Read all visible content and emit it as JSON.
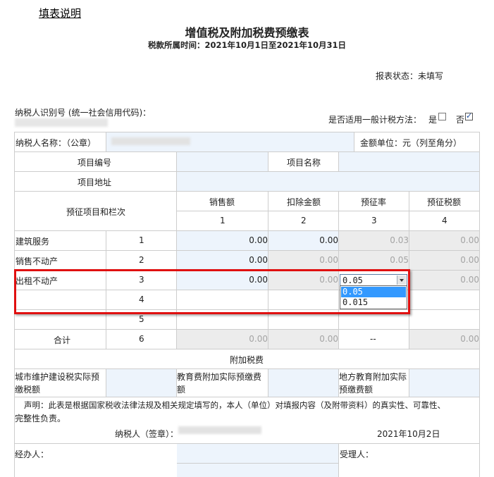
{
  "header": {
    "help_link": "填表说明",
    "title": "增值税及附加税费预缴表",
    "period": "税款所属时间：2021年10月1日至2021年10月31日",
    "status": "报表状态：未填写"
  },
  "taxpayer": {
    "id_label": "纳税人识别号 (统一社会信用代码)：",
    "general_method_label": "是否适用一般计税方法：",
    "yes_label": "是",
    "no_label": "否",
    "yes_checked": false,
    "no_checked": true,
    "name_label": "纳税人名称：（公章）",
    "amount_unit": "金额单位：元（列至角分）"
  },
  "project": {
    "number_label": "项目编号",
    "name_label": "项目名称",
    "address_label": "项目地址"
  },
  "table": {
    "item_header": "预征项目和栏次",
    "columns": [
      "销售额",
      "扣除金额",
      "预征率",
      "预征税额"
    ],
    "column_numbers": [
      "1",
      "2",
      "3",
      "4"
    ],
    "rows": [
      {
        "label": "建筑服务",
        "no": "1",
        "sales": "0.00",
        "deduct": "0.00",
        "rate": "0.03",
        "tax": "0.00"
      },
      {
        "label": "销售不动产",
        "no": "2",
        "sales": "0.00",
        "deduct": "0.00",
        "rate": "0.05",
        "tax": "0.00"
      },
      {
        "label": "出租不动产",
        "no": "3",
        "sales": "0.00",
        "deduct": "0.00",
        "rate": "0.05",
        "tax": "0.00"
      },
      {
        "label": "",
        "no": "4",
        "sales": "",
        "deduct": "",
        "rate": "",
        "tax": ""
      },
      {
        "label": "",
        "no": "5",
        "sales": "",
        "deduct": "",
        "rate": "",
        "tax": ""
      }
    ],
    "total": {
      "label": "合计",
      "no": "6",
      "sales": "0.00",
      "deduct": "0.00",
      "rate": "--",
      "tax": "0.00"
    }
  },
  "rate_dropdown": {
    "selected": "0.05",
    "options": [
      "0.05",
      "0.015"
    ]
  },
  "surcharge": {
    "title": "附加税费",
    "urban_label_1": "城市维护建设税实际预",
    "urban_label_2": "缴税额",
    "edu_label_1": "教育费附加实际预缴费",
    "edu_label_2": "额",
    "local_edu_label_1": "地方教育附加实际",
    "local_edu_label_2": "预缴费额"
  },
  "declaration": {
    "line1": "声明：此表是根据国家税收法律法规及相关规定填写的，本人（单位）对填报内容（及附带资料）的真实性、可靠性、",
    "line2": "完整性负责。",
    "signature_label": "纳税人（签章）：",
    "date": "2021年10月2日"
  },
  "footer": {
    "handler_label": "经办人：",
    "receiver_label": "受理人："
  },
  "colors": {
    "input_blue": "#edf4fc",
    "readonly_gray": "#ececec",
    "grid": "#cdcdcd",
    "highlight_red": "#e01010",
    "select_blue": "#3399ff"
  }
}
